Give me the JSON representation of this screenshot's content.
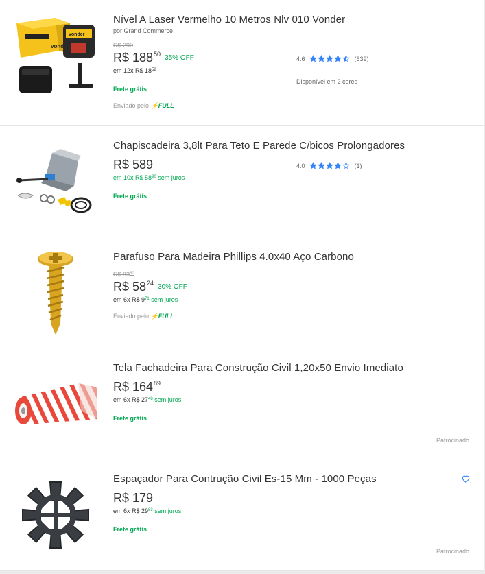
{
  "products": [
    {
      "title": "Nível A Laser Vermelho 10 Metros Nlv 010 Vonder",
      "seller": "por Grand Commerce",
      "old_price": "R$ 290",
      "price_int": "R$ 188",
      "price_cents": "50",
      "discount": "35% OFF",
      "installments": "em 12x R$ 18",
      "installments_cents": "52",
      "shipping": "Frete grátis",
      "fulfilled_prefix": "Enviado pelo",
      "fulfilled_brand": "FULL",
      "rating_value": "4.6",
      "rating_stars": 4.5,
      "rating_count": "(639)",
      "colors_note": "Disponível em 2 cores",
      "thumb_icon": "laser-level-image"
    },
    {
      "title": "Chapiscadeira 3,8lt Para Teto E Parede C/bicos Prolongadores",
      "price_int": "R$ 589",
      "installments": "em 10x R$ 58",
      "installments_cents": "90",
      "installments_suffix": "sem juros",
      "shipping": "Frete grátis",
      "rating_value": "4.0",
      "rating_stars": 4,
      "rating_count": "(1)",
      "thumb_icon": "plaster-sprayer-image"
    },
    {
      "title": "Parafuso Para Madeira Phillips 4.0x40 Aço Carbono",
      "old_price": "R$ 83",
      "old_price_cents": "80",
      "price_int": "R$ 58",
      "price_cents": "24",
      "discount": "30% OFF",
      "installments": "em 6x R$ 9",
      "installments_cents": "71",
      "installments_suffix": "sem juros",
      "fulfilled_prefix": "Enviado pelo",
      "fulfilled_brand": "FULL",
      "thumb_icon": "screw-image"
    },
    {
      "title": "Tela Fachadeira Para Construção Civil 1,20x50 Envio Imediato",
      "price_int": "R$ 164",
      "price_cents": "89",
      "installments": "em 6x R$ 27",
      "installments_cents": "48",
      "installments_suffix": "sem juros",
      "shipping": "Frete grátis",
      "sponsored": "Patrocinado",
      "thumb_icon": "facade-net-image"
    },
    {
      "title": "Espaçador Para Contrução Civil Es-15 Mm - 1000 Peças",
      "price_int": "R$ 179",
      "installments": "em 6x R$ 29",
      "installments_cents": "83",
      "installments_suffix": "sem juros",
      "shipping": "Frete grátis",
      "sponsored": "Patrocinado",
      "thumb_icon": "spacer-image"
    }
  ],
  "colors": {
    "green": "#00a650",
    "star_blue": "#3483fa",
    "text": "#333333",
    "muted": "#999999"
  }
}
